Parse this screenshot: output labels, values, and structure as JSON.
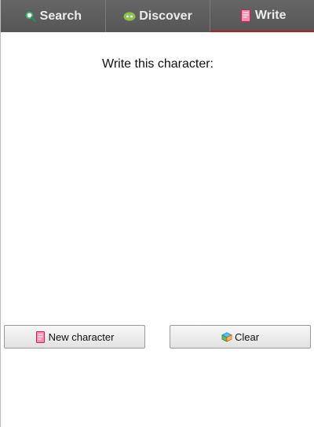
{
  "tabs": [
    {
      "label": "Search",
      "icon": "search-icon"
    },
    {
      "label": "Discover",
      "icon": "discover-icon"
    },
    {
      "label": "Write",
      "icon": "write-icon",
      "active": true
    }
  ],
  "main": {
    "prompt": "Write this character:"
  },
  "buttons": {
    "new_character": {
      "label": "New character",
      "icon": "notepad-icon"
    },
    "clear": {
      "label": "Clear",
      "icon": "eraser-icon"
    }
  },
  "colors": {
    "tabbar": "#5f5f5f",
    "tab_text": "#ececec",
    "active_underline": "#b22222",
    "search_icon": "#3cb371",
    "discover_icon": "#8bc34a",
    "write_icon": "#f06292"
  }
}
